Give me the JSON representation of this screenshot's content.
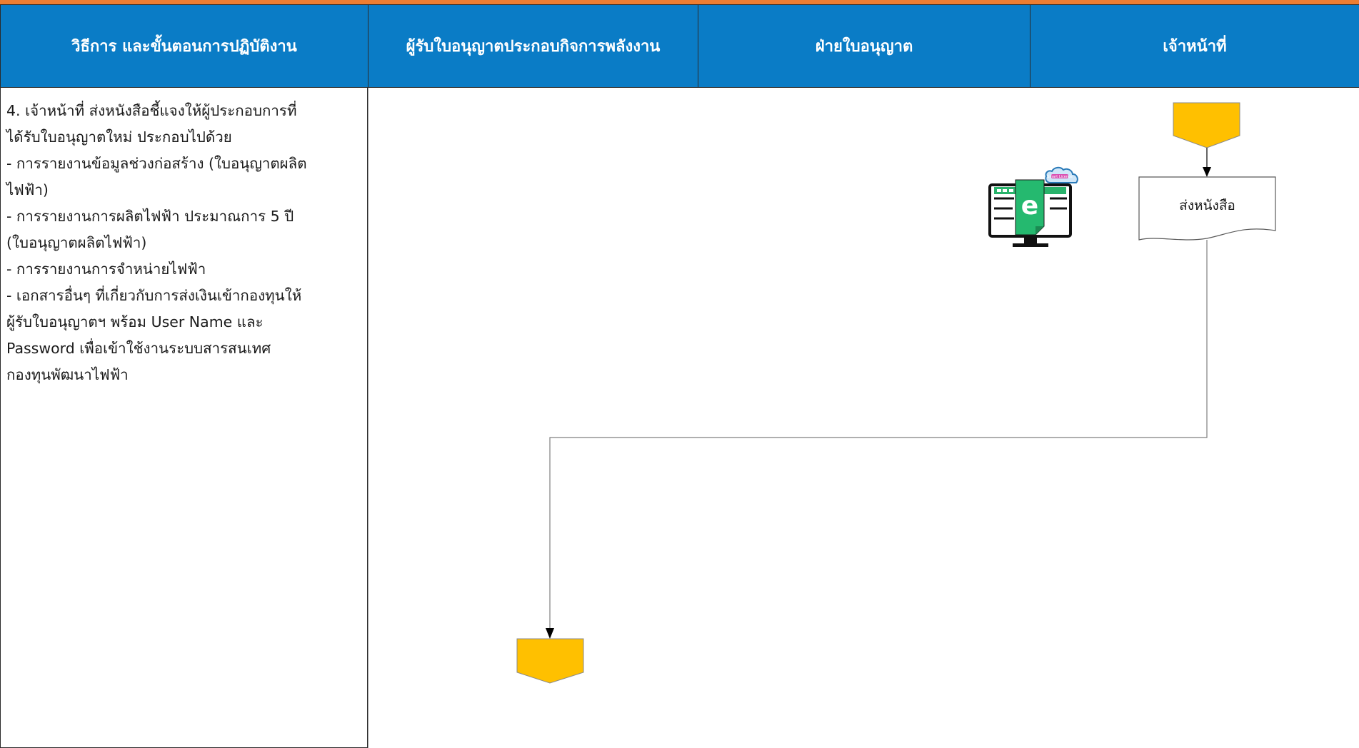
{
  "header": {
    "col1": "วิธีการ และขั้นตอนการปฏิบัติงาน",
    "col2": "ผู้รับใบอนุญาตประกอบกิจการพลังงาน",
    "col3": "ฝ่ายใบอนุญาต",
    "col4": "เจ้าหน้าที่"
  },
  "description": {
    "lines": [
      "4. เจ้าหน้าที่ ส่งหนังสือชี้แจงให้ผู้ประกอบการที่",
      "ได้รับใบอนุญาตใหม่  ประกอบไปด้วย",
      "- การรายงานข้อมูลช่วงก่อสร้าง (ใบอนุญาตผลิต",
      "ไฟฟ้า)",
      "- การรายงานการผลิตไฟฟ้า ประมาณการ 5 ปี",
      "(ใบอนุญาตผลิตไฟฟ้า)",
      "- การรายงานการจำหน่ายไฟฟ้า",
      "- เอกสารอื่นๆ ที่เกี่ยวกับการส่งเงินเข้ากองทุนให้",
      "ผู้รับใบอนุญาตฯ พร้อม User Name และ",
      "Password เพื่อเข้าใช้งานระบบสารสนเทศ",
      "กองทุนพัฒนาไฟฟ้า"
    ]
  },
  "flow": {
    "document_label": "ส่งหนังสือ",
    "monitor_letter": "e",
    "cloud_label": "Smart Licence"
  },
  "colors": {
    "header_bg": "#0a7cc6",
    "top_bar": "#ed7d31",
    "connector_fill": "#ffc000",
    "monitor_green": "#25b96f"
  },
  "icons": {
    "connector_top": "offpage-connector-icon",
    "connector_bottom": "offpage-connector-icon",
    "monitor": "e-document-monitor-icon"
  }
}
